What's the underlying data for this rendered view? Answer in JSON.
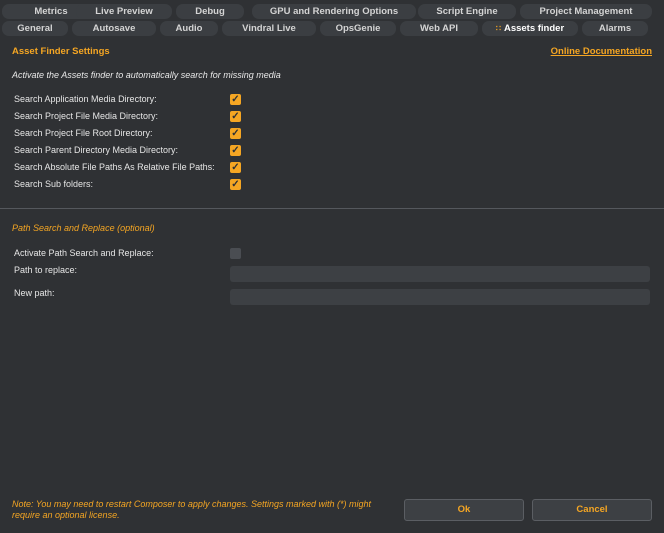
{
  "tabs_row1": [
    {
      "label": "Metrics"
    },
    {
      "label": "Live Preview"
    },
    {
      "label": "Debug"
    },
    {
      "label": "GPU and Rendering Options"
    },
    {
      "label": "Script Engine"
    },
    {
      "label": "Project Management"
    }
  ],
  "tabs_row2": [
    {
      "label": "General"
    },
    {
      "label": "Autosave"
    },
    {
      "label": "Audio"
    },
    {
      "label": "Vindral Live"
    },
    {
      "label": "OpsGenie"
    },
    {
      "label": "Web API"
    },
    {
      "label": "Assets finder"
    },
    {
      "label": "Alarms"
    }
  ],
  "header": {
    "title": "Asset Finder Settings",
    "doc_link": "Online Documentation"
  },
  "hint": "Activate the Assets finder to automatically search for missing media",
  "options": [
    {
      "label": "Search Application Media Directory:",
      "checked": true
    },
    {
      "label": "Search Project File Media Directory:",
      "checked": true
    },
    {
      "label": "Search Project File Root Directory:",
      "checked": true
    },
    {
      "label": "Search Parent Directory Media Directory:",
      "checked": true
    },
    {
      "label": "Search Absolute File Paths As Relative File Paths:",
      "checked": true
    },
    {
      "label": "Search Sub folders:",
      "checked": true
    }
  ],
  "path_section": {
    "title": "Path Search and Replace (optional)",
    "activate_label": "Activate Path Search and Replace:",
    "activate_checked": false,
    "path_label": "Path to replace:",
    "path_value": "",
    "new_label": "New path:",
    "new_value": ""
  },
  "footer": {
    "note": "Note: You may need to restart Composer to apply changes. Settings marked with (*) might require an optional license.",
    "ok_label": "Ok",
    "cancel_label": "Cancel"
  },
  "colors": {
    "accent": "#f5a623",
    "background": "#2f3134"
  }
}
